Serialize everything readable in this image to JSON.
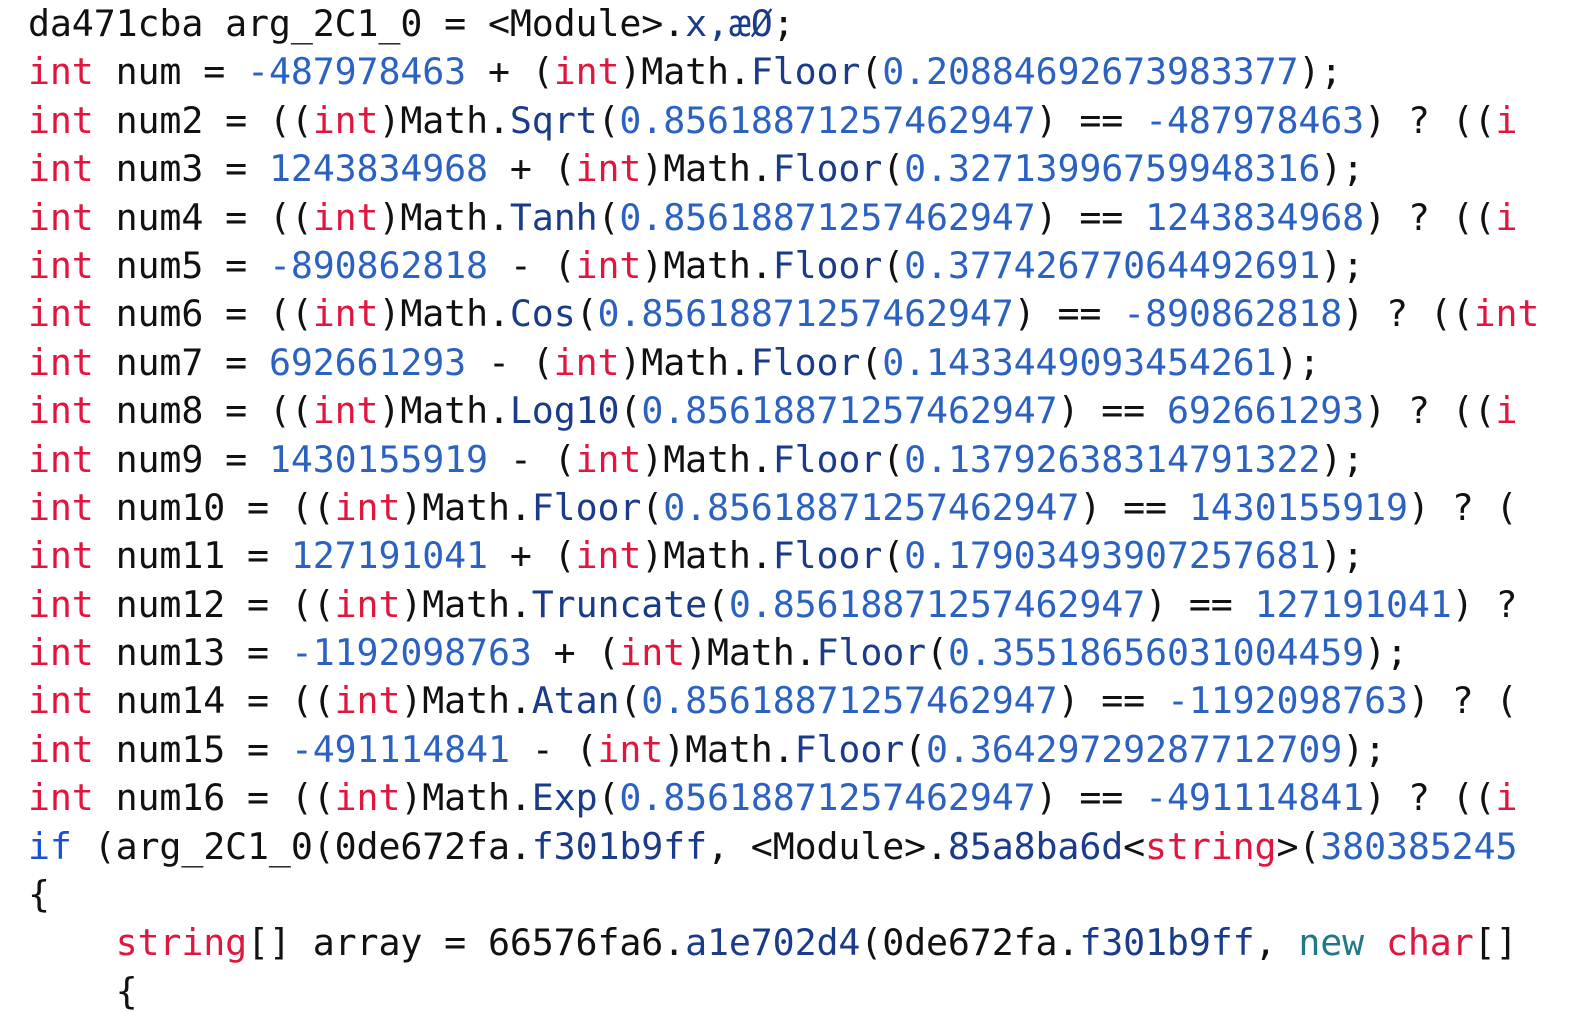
{
  "colors": {
    "background": "#ffffff",
    "keyword_int": "#e0163f",
    "keyword_if": "#1a4fd6",
    "number": "#2b62c2",
    "member": "#1a3a8a",
    "keyword_new": "#1f7a83",
    "plain": "#111111"
  },
  "code_lines": [
    [
      [
        "pl",
        "da471cba arg_2C1_0 = <Module>."
      ],
      [
        "fn",
        "x,æØ"
      ],
      [
        "pl",
        ";"
      ]
    ],
    [
      [
        "kw",
        "int"
      ],
      [
        "pl",
        " num = "
      ],
      [
        "num",
        "-487978463"
      ],
      [
        "pl",
        " + ("
      ],
      [
        "kw",
        "int"
      ],
      [
        "pl",
        ")Math."
      ],
      [
        "fn",
        "Floor"
      ],
      [
        "pl",
        "("
      ],
      [
        "num",
        "0.20884692673983377"
      ],
      [
        "pl",
        ");"
      ]
    ],
    [
      [
        "kw",
        "int"
      ],
      [
        "pl",
        " num2 = (("
      ],
      [
        "kw",
        "int"
      ],
      [
        "pl",
        ")Math."
      ],
      [
        "fn",
        "Sqrt"
      ],
      [
        "pl",
        "("
      ],
      [
        "num",
        "0.85618871257462947"
      ],
      [
        "pl",
        ") == "
      ],
      [
        "num",
        "-487978463"
      ],
      [
        "pl",
        ") ? (("
      ],
      [
        "kw",
        "i"
      ]
    ],
    [
      [
        "kw",
        "int"
      ],
      [
        "pl",
        " num3 = "
      ],
      [
        "num",
        "1243834968"
      ],
      [
        "pl",
        " + ("
      ],
      [
        "kw",
        "int"
      ],
      [
        "pl",
        ")Math."
      ],
      [
        "fn",
        "Floor"
      ],
      [
        "pl",
        "("
      ],
      [
        "num",
        "0.32713996759948316"
      ],
      [
        "pl",
        ");"
      ]
    ],
    [
      [
        "kw",
        "int"
      ],
      [
        "pl",
        " num4 = (("
      ],
      [
        "kw",
        "int"
      ],
      [
        "pl",
        ")Math."
      ],
      [
        "fn",
        "Tanh"
      ],
      [
        "pl",
        "("
      ],
      [
        "num",
        "0.85618871257462947"
      ],
      [
        "pl",
        ") == "
      ],
      [
        "num",
        "1243834968"
      ],
      [
        "pl",
        ") ? (("
      ],
      [
        "kw",
        "i"
      ]
    ],
    [
      [
        "kw",
        "int"
      ],
      [
        "pl",
        " num5 = "
      ],
      [
        "num",
        "-890862818"
      ],
      [
        "pl",
        " - ("
      ],
      [
        "kw",
        "int"
      ],
      [
        "pl",
        ")Math."
      ],
      [
        "fn",
        "Floor"
      ],
      [
        "pl",
        "("
      ],
      [
        "num",
        "0.37742677064492691"
      ],
      [
        "pl",
        ");"
      ]
    ],
    [
      [
        "kw",
        "int"
      ],
      [
        "pl",
        " num6 = (("
      ],
      [
        "kw",
        "int"
      ],
      [
        "pl",
        ")Math."
      ],
      [
        "fn",
        "Cos"
      ],
      [
        "pl",
        "("
      ],
      [
        "num",
        "0.85618871257462947"
      ],
      [
        "pl",
        ") == "
      ],
      [
        "num",
        "-890862818"
      ],
      [
        "pl",
        ") ? (("
      ],
      [
        "kw",
        "int"
      ]
    ],
    [
      [
        "kw",
        "int"
      ],
      [
        "pl",
        " num7 = "
      ],
      [
        "num",
        "692661293"
      ],
      [
        "pl",
        " - ("
      ],
      [
        "kw",
        "int"
      ],
      [
        "pl",
        ")Math."
      ],
      [
        "fn",
        "Floor"
      ],
      [
        "pl",
        "("
      ],
      [
        "num",
        "0.1433449093454261"
      ],
      [
        "pl",
        ");"
      ]
    ],
    [
      [
        "kw",
        "int"
      ],
      [
        "pl",
        " num8 = (("
      ],
      [
        "kw",
        "int"
      ],
      [
        "pl",
        ")Math."
      ],
      [
        "fn",
        "Log10"
      ],
      [
        "pl",
        "("
      ],
      [
        "num",
        "0.85618871257462947"
      ],
      [
        "pl",
        ") == "
      ],
      [
        "num",
        "692661293"
      ],
      [
        "pl",
        ") ? (("
      ],
      [
        "kw",
        "i"
      ]
    ],
    [
      [
        "kw",
        "int"
      ],
      [
        "pl",
        " num9 = "
      ],
      [
        "num",
        "1430155919"
      ],
      [
        "pl",
        " - ("
      ],
      [
        "kw",
        "int"
      ],
      [
        "pl",
        ")Math."
      ],
      [
        "fn",
        "Floor"
      ],
      [
        "pl",
        "("
      ],
      [
        "num",
        "0.13792638314791322"
      ],
      [
        "pl",
        ");"
      ]
    ],
    [
      [
        "kw",
        "int"
      ],
      [
        "pl",
        " num10 = (("
      ],
      [
        "kw",
        "int"
      ],
      [
        "pl",
        ")Math."
      ],
      [
        "fn",
        "Floor"
      ],
      [
        "pl",
        "("
      ],
      [
        "num",
        "0.85618871257462947"
      ],
      [
        "pl",
        ") == "
      ],
      [
        "num",
        "1430155919"
      ],
      [
        "pl",
        ") ? ("
      ]
    ],
    [
      [
        "kw",
        "int"
      ],
      [
        "pl",
        " num11 = "
      ],
      [
        "num",
        "127191041"
      ],
      [
        "pl",
        " + ("
      ],
      [
        "kw",
        "int"
      ],
      [
        "pl",
        ")Math."
      ],
      [
        "fn",
        "Floor"
      ],
      [
        "pl",
        "("
      ],
      [
        "num",
        "0.17903493907257681"
      ],
      [
        "pl",
        ");"
      ]
    ],
    [
      [
        "kw",
        "int"
      ],
      [
        "pl",
        " num12 = (("
      ],
      [
        "kw",
        "int"
      ],
      [
        "pl",
        ")Math."
      ],
      [
        "fn",
        "Truncate"
      ],
      [
        "pl",
        "("
      ],
      [
        "num",
        "0.85618871257462947"
      ],
      [
        "pl",
        ") == "
      ],
      [
        "num",
        "127191041"
      ],
      [
        "pl",
        ") ?"
      ]
    ],
    [
      [
        "kw",
        "int"
      ],
      [
        "pl",
        " num13 = "
      ],
      [
        "num",
        "-1192098763"
      ],
      [
        "pl",
        " + ("
      ],
      [
        "kw",
        "int"
      ],
      [
        "pl",
        ")Math."
      ],
      [
        "fn",
        "Floor"
      ],
      [
        "pl",
        "("
      ],
      [
        "num",
        "0.35518656031004459"
      ],
      [
        "pl",
        ");"
      ]
    ],
    [
      [
        "kw",
        "int"
      ],
      [
        "pl",
        " num14 = (("
      ],
      [
        "kw",
        "int"
      ],
      [
        "pl",
        ")Math."
      ],
      [
        "fn",
        "Atan"
      ],
      [
        "pl",
        "("
      ],
      [
        "num",
        "0.85618871257462947"
      ],
      [
        "pl",
        ") == "
      ],
      [
        "num",
        "-1192098763"
      ],
      [
        "pl",
        ") ? ("
      ]
    ],
    [
      [
        "kw",
        "int"
      ],
      [
        "pl",
        " num15 = "
      ],
      [
        "num",
        "-491114841"
      ],
      [
        "pl",
        " - ("
      ],
      [
        "kw",
        "int"
      ],
      [
        "pl",
        ")Math."
      ],
      [
        "fn",
        "Floor"
      ],
      [
        "pl",
        "("
      ],
      [
        "num",
        "0.36429729287712709"
      ],
      [
        "pl",
        ");"
      ]
    ],
    [
      [
        "kw",
        "int"
      ],
      [
        "pl",
        " num16 = (("
      ],
      [
        "kw",
        "int"
      ],
      [
        "pl",
        ")Math."
      ],
      [
        "fn",
        "Exp"
      ],
      [
        "pl",
        "("
      ],
      [
        "num",
        "0.85618871257462947"
      ],
      [
        "pl",
        ") == "
      ],
      [
        "num",
        "-491114841"
      ],
      [
        "pl",
        ") ? (("
      ],
      [
        "kw",
        "i"
      ]
    ],
    [
      [
        "kwb",
        "if"
      ],
      [
        "pl",
        " (arg_2C1_0(0de672fa."
      ],
      [
        "fn",
        "f301b9ff"
      ],
      [
        "pl",
        ", <Module>."
      ],
      [
        "fn",
        "85a8ba6d"
      ],
      [
        "pl",
        "<"
      ],
      [
        "kw",
        "string"
      ],
      [
        "pl",
        ">("
      ],
      [
        "num",
        "380385245"
      ]
    ],
    [
      [
        "pl",
        "{"
      ]
    ],
    [
      [
        "pl",
        "    "
      ],
      [
        "kw",
        "string"
      ],
      [
        "pl",
        "[] array = 66576fa6."
      ],
      [
        "fn",
        "a1e702d4"
      ],
      [
        "pl",
        "(0de672fa."
      ],
      [
        "fn",
        "f301b9ff"
      ],
      [
        "pl",
        ", "
      ],
      [
        "tn",
        "new"
      ],
      [
        "pl",
        " "
      ],
      [
        "kw",
        "char"
      ],
      [
        "pl",
        "[]"
      ]
    ],
    [
      [
        "pl",
        "    {"
      ]
    ]
  ]
}
